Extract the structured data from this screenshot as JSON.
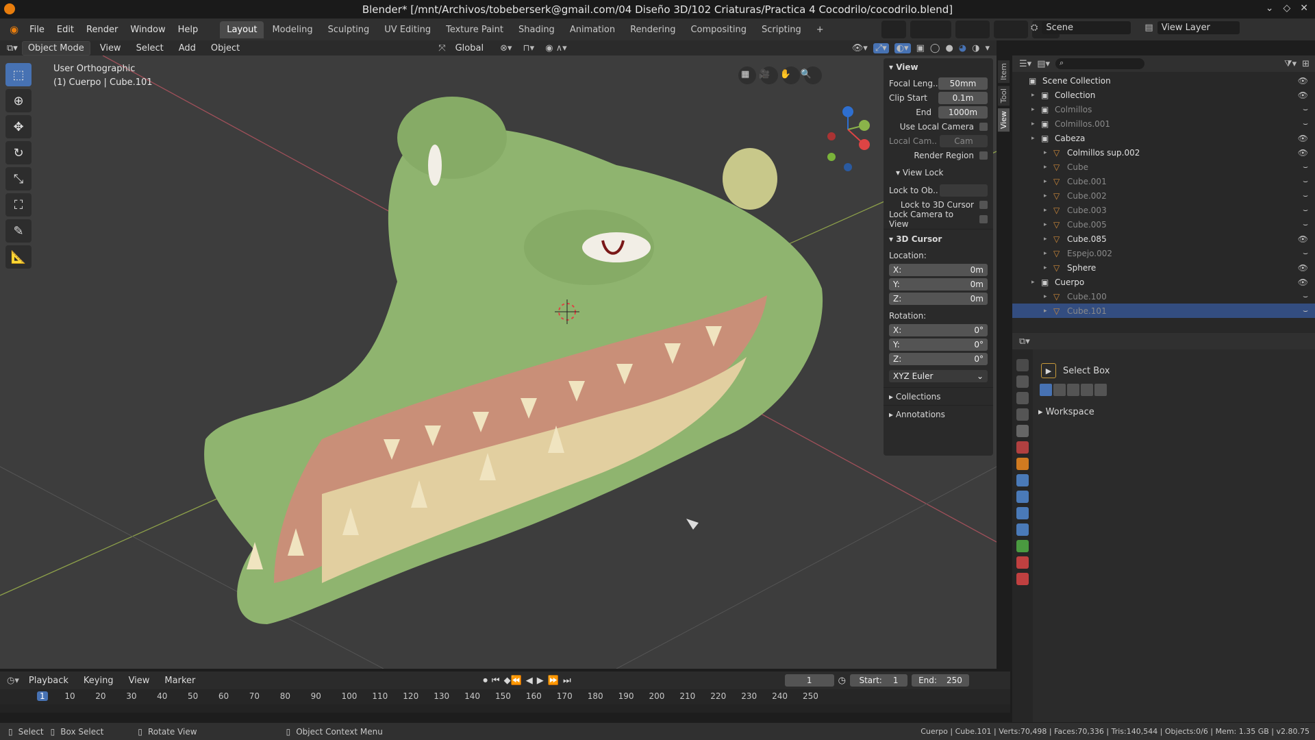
{
  "title": "Blender* [/mnt/Archivos/tobeberserk@gmail.com/04 Diseño 3D/102 Criaturas/Practica 4 Cocodrilo/cocodrilo.blend]",
  "menus": [
    "File",
    "Edit",
    "Render",
    "Window",
    "Help"
  ],
  "workspaces": [
    "Layout",
    "Modeling",
    "Sculpting",
    "UV Editing",
    "Texture Paint",
    "Shading",
    "Animation",
    "Rendering",
    "Compositing",
    "Scripting",
    "+"
  ],
  "scene": "Scene",
  "view_layer": "View Layer",
  "header": {
    "mode": "Object Mode",
    "items": [
      "View",
      "Select",
      "Add",
      "Object"
    ],
    "orientation": "Global"
  },
  "viewport": {
    "view_name": "User Orthographic",
    "object_info": "(1) Cuerpo | Cube.101"
  },
  "npanel": {
    "view_header": "View",
    "focal_label": "Focal Leng..",
    "focal_value": "50mm",
    "clip_start_label": "Clip Start",
    "clip_start_value": "0.1m",
    "end_label": "End",
    "end_value": "1000m",
    "use_local_camera": "Use Local Camera",
    "local_cam_label": "Local Cam..",
    "local_cam_value": "Cam",
    "render_region": "Render Region",
    "view_lock_header": "View Lock",
    "lock_to_ob": "Lock to Ob..",
    "lock_3d_cursor": "Lock to 3D Cursor",
    "lock_camera": "Lock Camera to View",
    "cursor_header": "3D Cursor",
    "location_label": "Location:",
    "loc_x": "0m",
    "loc_y": "0m",
    "loc_z": "0m",
    "rotation_label": "Rotation:",
    "rot_x": "0°",
    "rot_y": "0°",
    "rot_z": "0°",
    "euler": "XYZ Euler",
    "collections": "Collections",
    "annotations": "Annotations",
    "x": "X:",
    "y": "Y:",
    "z": "Z:"
  },
  "side_tabs": [
    "Item",
    "Tool",
    "View"
  ],
  "outliner": [
    {
      "name": "Scene Collection",
      "indent": 0
    },
    {
      "name": "Collection",
      "indent": 1
    },
    {
      "name": "Colmillos",
      "indent": 1,
      "dim": true
    },
    {
      "name": "Colmillos.001",
      "indent": 1,
      "dim": true
    },
    {
      "name": "Cabeza",
      "indent": 1
    },
    {
      "name": "Colmillos sup.002",
      "indent": 2
    },
    {
      "name": "Cube",
      "indent": 2,
      "dim": true
    },
    {
      "name": "Cube.001",
      "indent": 2,
      "dim": true
    },
    {
      "name": "Cube.002",
      "indent": 2,
      "dim": true
    },
    {
      "name": "Cube.003",
      "indent": 2,
      "dim": true
    },
    {
      "name": "Cube.005",
      "indent": 2,
      "dim": true
    },
    {
      "name": "Cube.085",
      "indent": 2
    },
    {
      "name": "Espejo.002",
      "indent": 2,
      "dim": true
    },
    {
      "name": "Sphere",
      "indent": 2
    },
    {
      "name": "Cuerpo",
      "indent": 1
    },
    {
      "name": "Cube.100",
      "indent": 2,
      "dim": true
    },
    {
      "name": "Cube.101",
      "indent": 2,
      "dim": true,
      "selected": true
    }
  ],
  "props": {
    "tool": "Select Box",
    "workspace": "Workspace"
  },
  "timeline": {
    "menus": [
      "Playback",
      "Keying",
      "View",
      "Marker"
    ],
    "frame": "1",
    "start_label": "Start:",
    "start": "1",
    "end_label": "End:",
    "end": "250",
    "ticks": [
      "1",
      "10",
      "20",
      "30",
      "40",
      "50",
      "60",
      "70",
      "80",
      "90",
      "100",
      "110",
      "120",
      "130",
      "140",
      "150",
      "160",
      "170",
      "180",
      "190",
      "200",
      "210",
      "220",
      "230",
      "240",
      "250"
    ]
  },
  "status": {
    "select": "Select",
    "box_select": "Box Select",
    "rotate": "Rotate View",
    "context": "Object Context Menu",
    "stats": "Cuerpo | Cube.101 | Verts:70,498 | Faces:70,336 | Tris:140,544 | Objects:0/6 | Mem: 1.35 GB | v2.80.75"
  },
  "colors": {
    "accent": "#4772b3",
    "selection": "#334d80",
    "croc": "#8fb46f"
  }
}
